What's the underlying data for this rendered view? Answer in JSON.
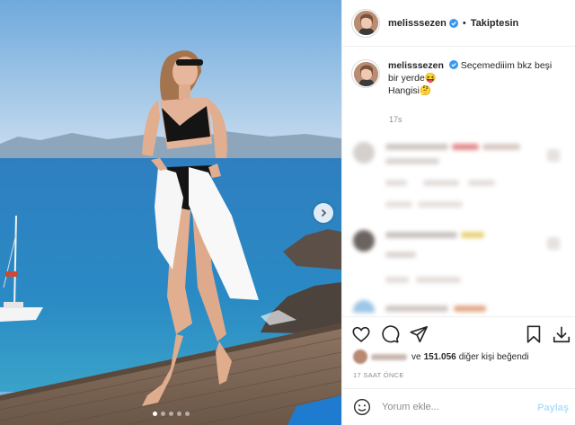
{
  "header": {
    "username": "melisssezen",
    "separator": "•",
    "follow_status": "Takiptesin"
  },
  "caption": {
    "username": "melisssezen",
    "text": "Seçemediiim bkz beşi bir yerde😝",
    "text2": "Hangisi🤔",
    "timestamp": "17s"
  },
  "photo": {
    "slide_count": 5,
    "active_slide": 0
  },
  "likes": {
    "prefix": "ve",
    "count": "151.056",
    "suffix": "diğer kişi beğendi"
  },
  "post_time": "17 SAAT ÖNCE",
  "comment": {
    "placeholder": "Yorum ekle...",
    "post_label": "Paylaş"
  },
  "colors": {
    "verified_blue": "#3897f0",
    "post_button_disabled": "#b2dffc",
    "meta_gray": "#8e8e8e"
  },
  "icons": {
    "like": "heart-icon",
    "comment": "comment-icon",
    "share": "paper-plane-icon",
    "save": "bookmark-icon",
    "download": "download-icon",
    "emoji": "smiley-icon",
    "next": "chevron-right-icon"
  }
}
